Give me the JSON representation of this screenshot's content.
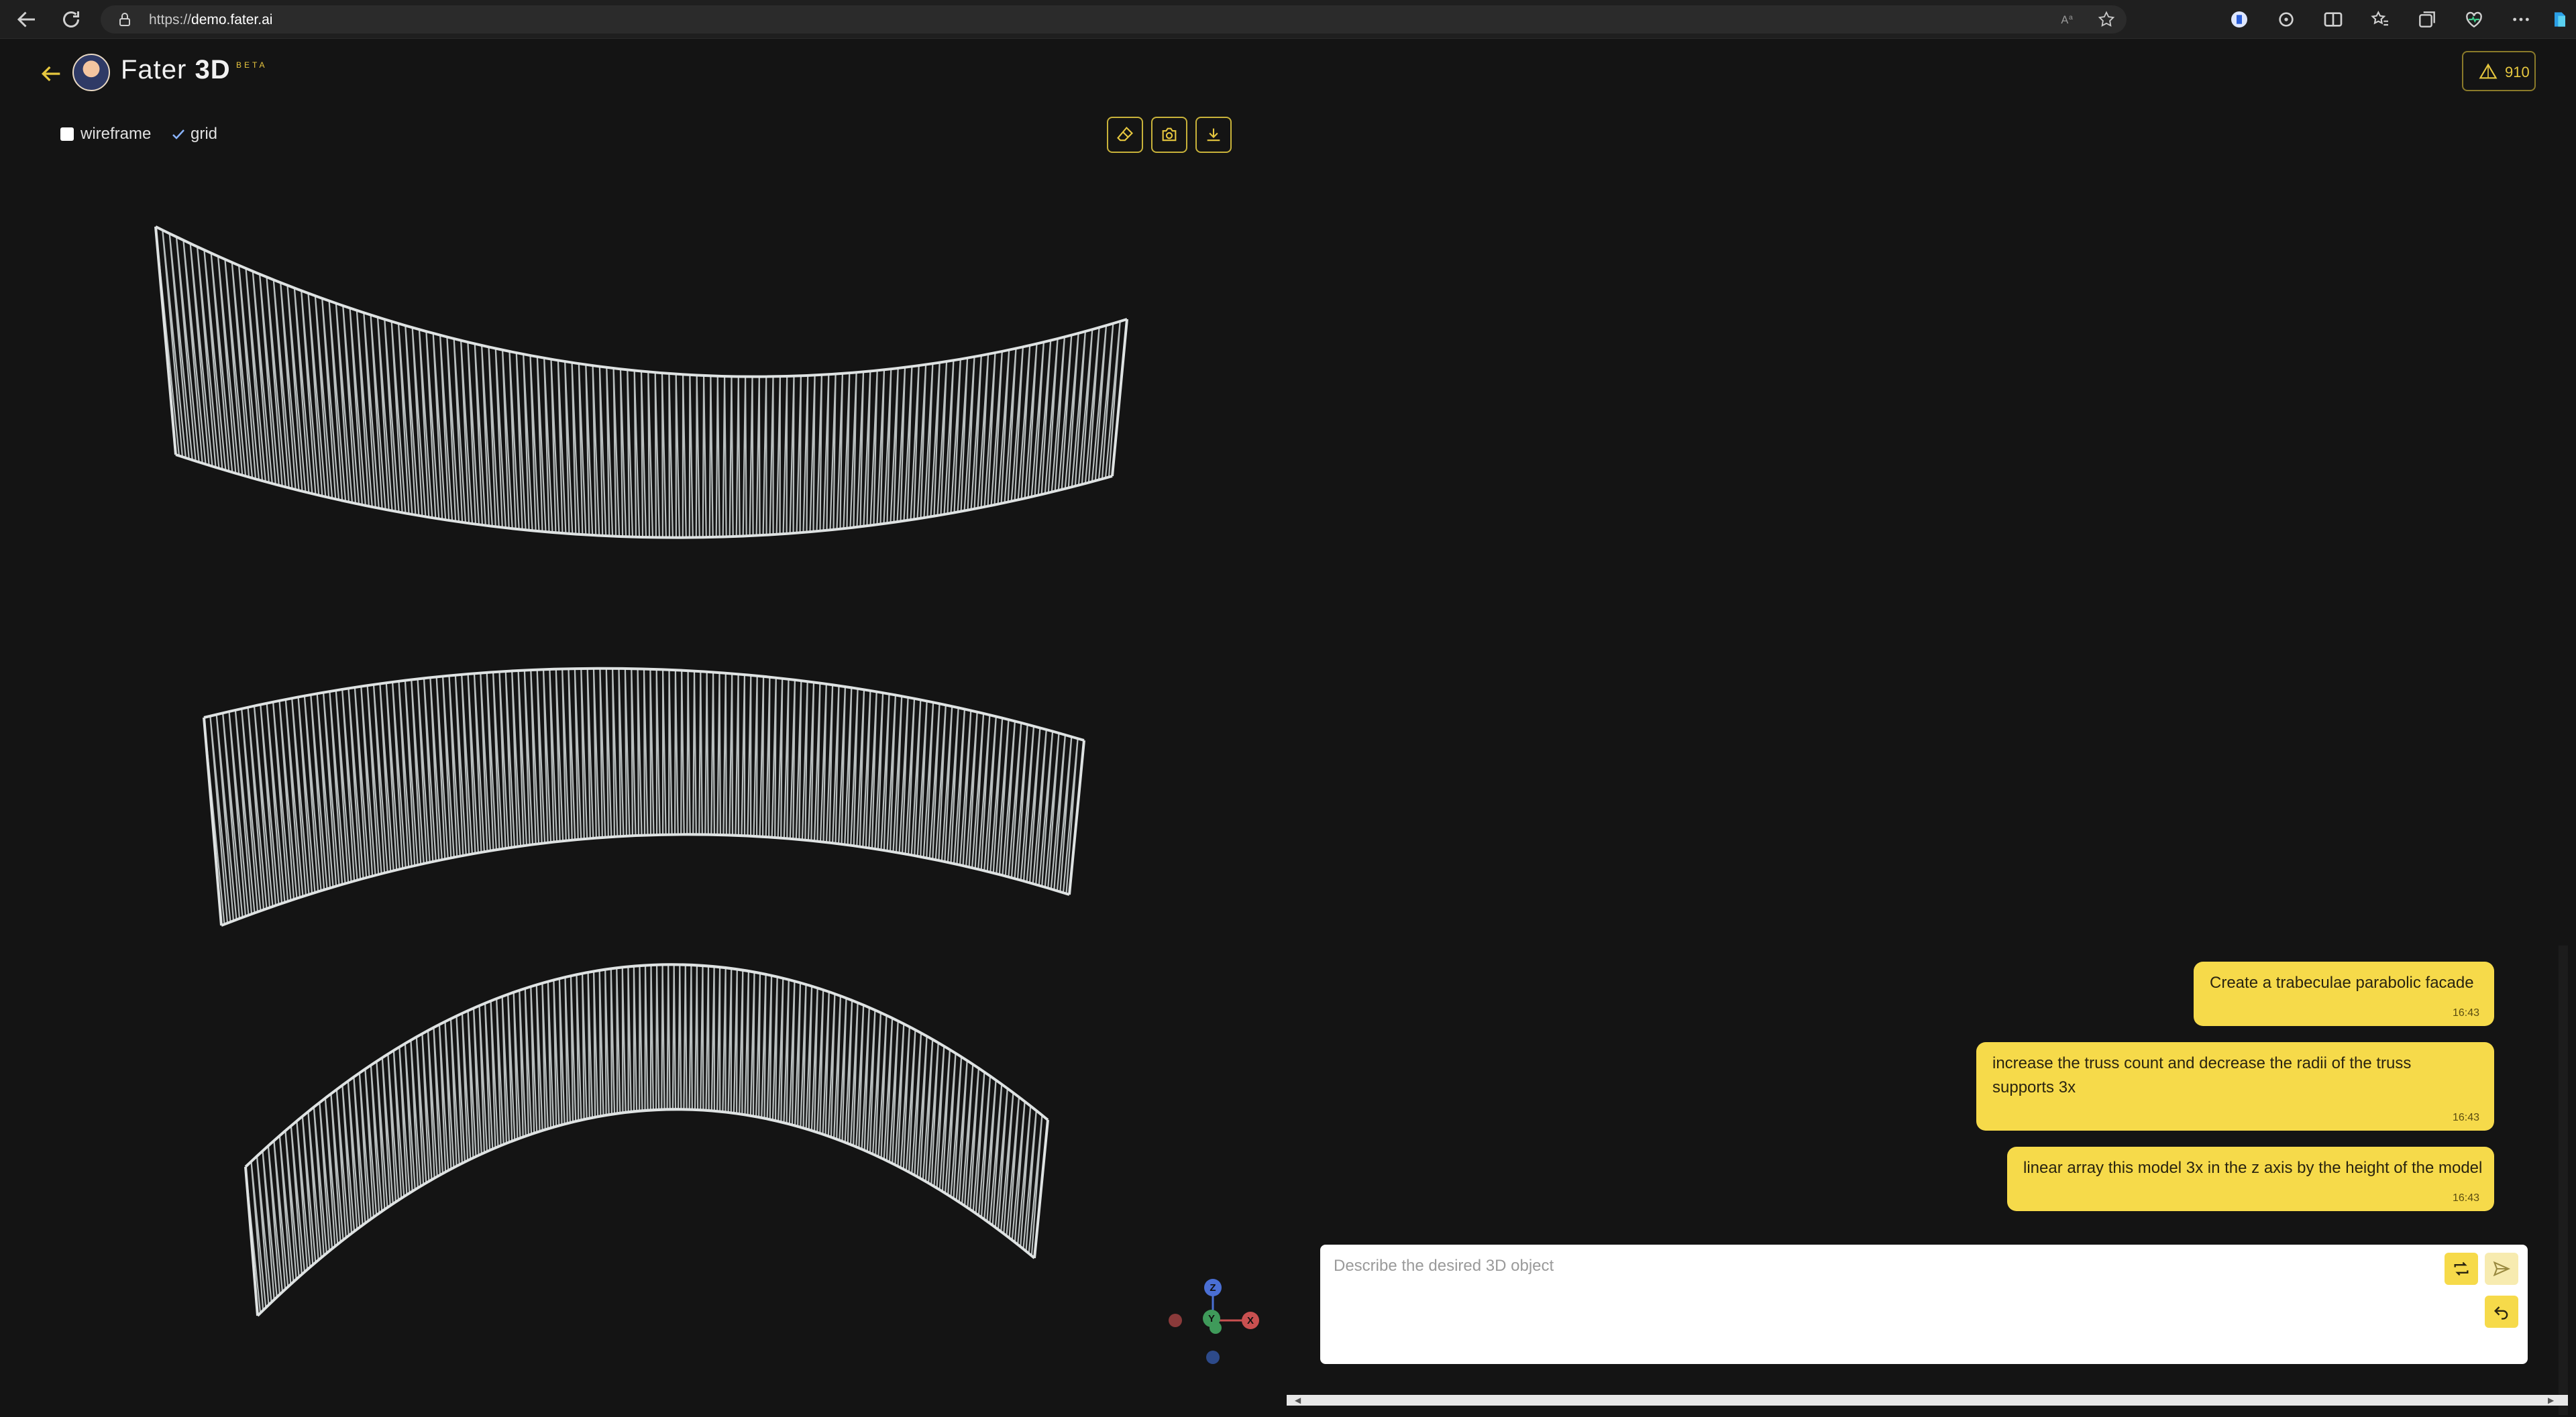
{
  "browser": {
    "url_prefix": "https://",
    "url_host": "demo.fater.ai"
  },
  "app": {
    "logo_light": "Fater",
    "logo_bold": "3D",
    "beta_label": "BETA",
    "credits": "910"
  },
  "viewer": {
    "wireframe_label": "wireframe",
    "wireframe_checked": false,
    "grid_label": "grid",
    "grid_checked": true,
    "gizmo": {
      "z": "Z",
      "y": "Y",
      "x": "X"
    }
  },
  "chat": {
    "messages": [
      {
        "text": "Create a trabeculae parabolic facade",
        "time": "16:43"
      },
      {
        "text": "increase the truss count and decrease the radii of the truss supports 3x",
        "time": "16:43"
      },
      {
        "text": "linear array this model 3x in the z axis by the height of the model",
        "time": "16:43"
      }
    ],
    "input_placeholder": "Describe the desired 3D object"
  },
  "colors": {
    "accent": "#f6da4a",
    "background": "#141414",
    "model": "#b9bfbf"
  },
  "icons": [
    "back-arrow-icon",
    "refresh-icon",
    "lock-icon",
    "eraser-icon",
    "camera-icon",
    "download-icon",
    "triangle-icon",
    "repeat-icon",
    "send-icon",
    "undo-icon"
  ]
}
